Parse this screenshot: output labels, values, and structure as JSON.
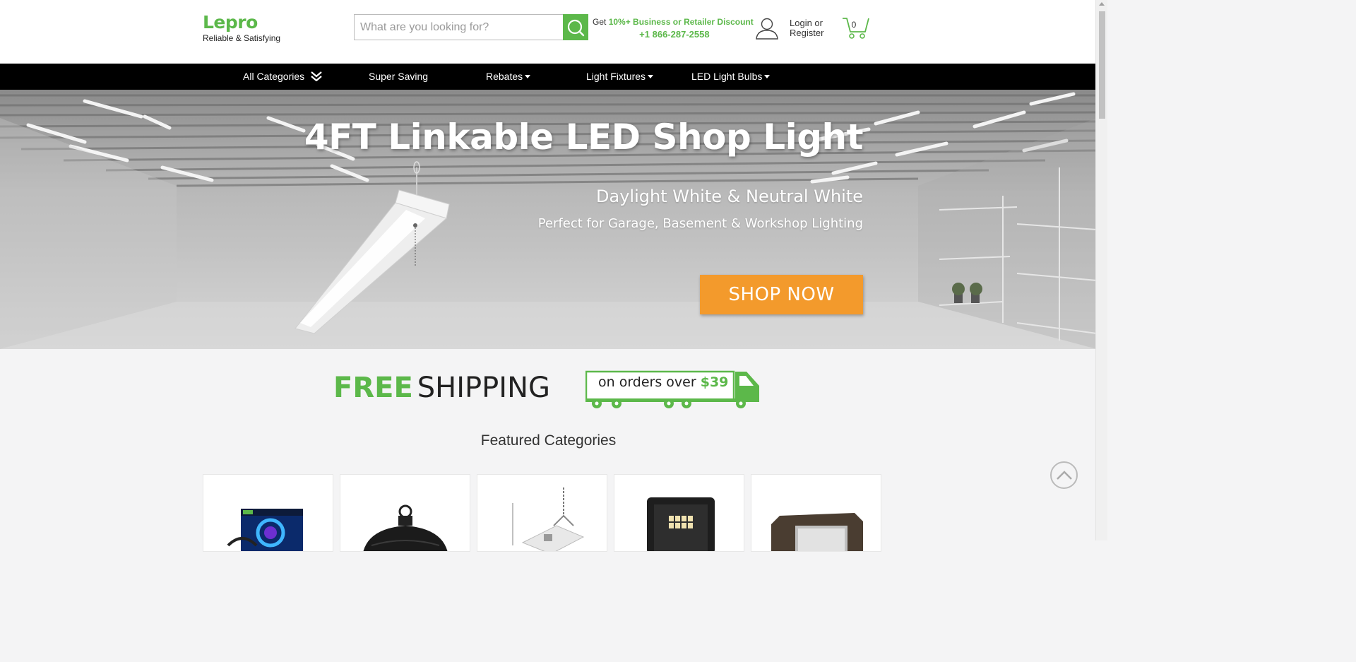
{
  "header": {
    "logo_text": "Lepro",
    "tagline": "Reliable & Satisfying",
    "search_placeholder": "What are you looking for?",
    "promo_get": "Get ",
    "promo_discount": "10%+ Business or Retailer Discount",
    "promo_phone": "+1 866-287-2558",
    "login_line1": "Login or",
    "login_line2": "Register",
    "cart_count": "0"
  },
  "nav": {
    "items": [
      {
        "label": "All Categories"
      },
      {
        "label": "Super Saving"
      },
      {
        "label": "Rebates"
      },
      {
        "label": "Light Fixtures"
      },
      {
        "label": "LED Light Bulbs"
      }
    ]
  },
  "hero": {
    "title": "4FT Linkable LED Shop Light",
    "subtitle": "Daylight White & Neutral White",
    "tagline": "Perfect for Garage, Basement & Workshop Lighting",
    "cta": "SHOP NOW"
  },
  "shipping": {
    "free": "FREE",
    "shipping": "SHIPPING",
    "orders_over": "on orders over ",
    "amount": "$39"
  },
  "featured": {
    "title": "Featured Categories"
  },
  "colors": {
    "brand_green": "#5cb84a",
    "cta_orange": "#f39a2c",
    "nav_black": "#000000"
  }
}
